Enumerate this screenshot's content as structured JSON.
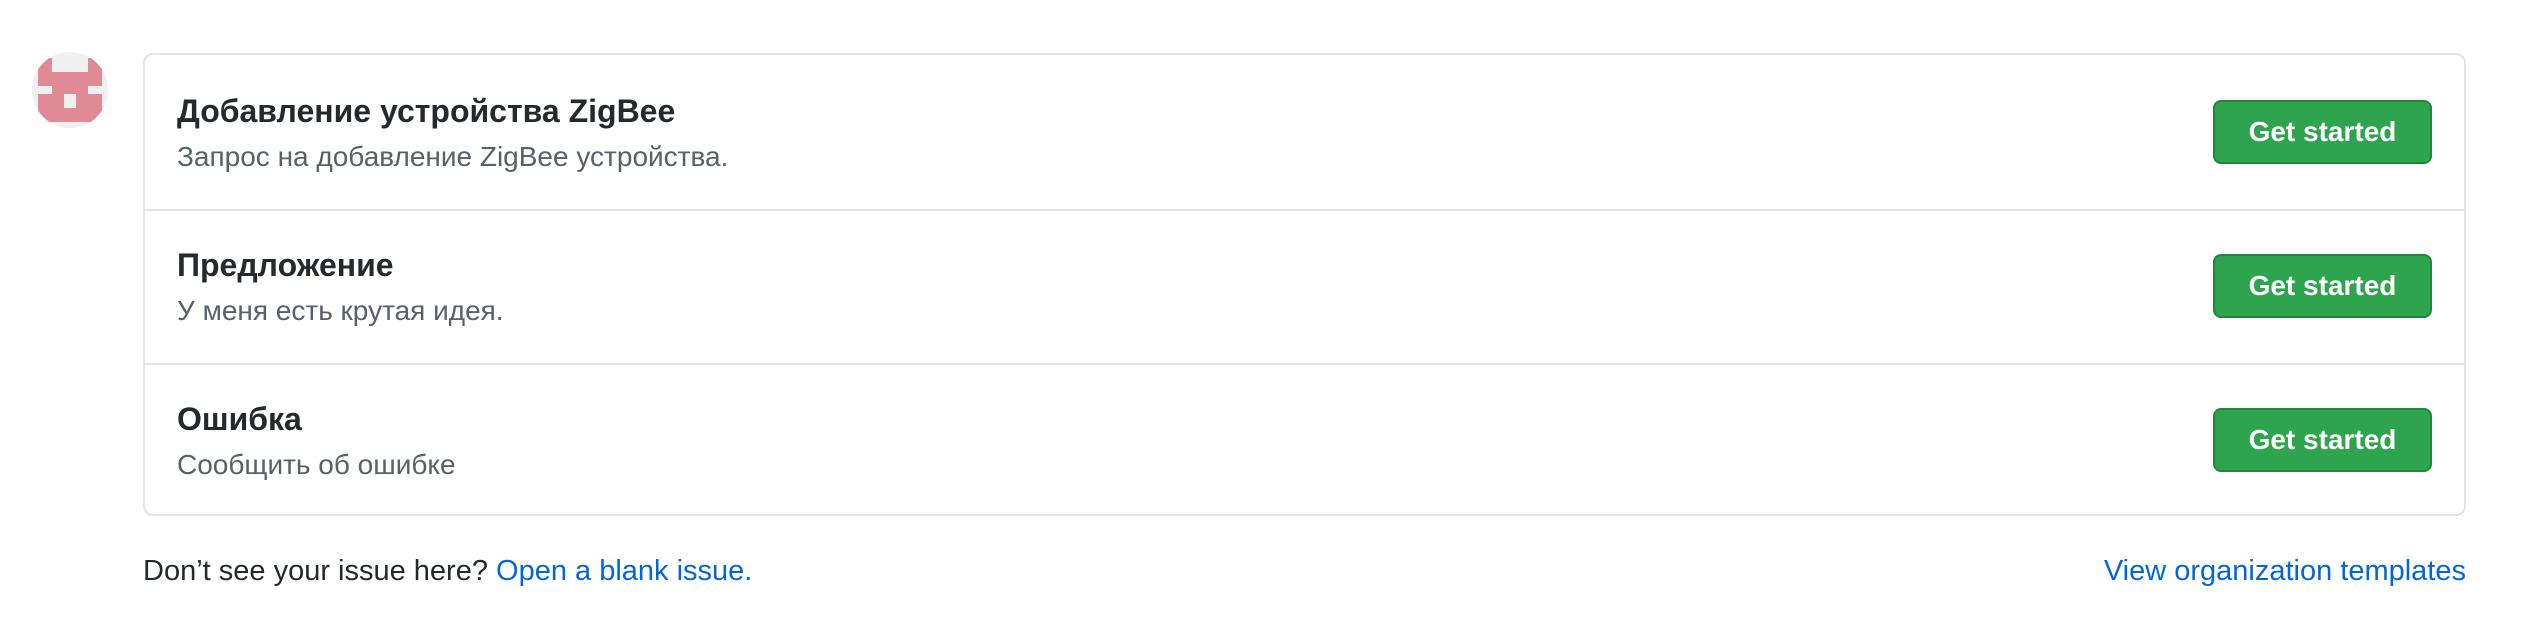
{
  "avatar": {
    "icon": "identicon-avatar",
    "color": "#e08a95"
  },
  "templates": [
    {
      "title": "Добавление устройства ZigBee",
      "description": "Запрос на добавление ZigBee устройства.",
      "button_label": "Get started"
    },
    {
      "title": "Предложение",
      "description": "У меня есть крутая идея.",
      "button_label": "Get started"
    },
    {
      "title": "Ошибка",
      "description": "Сообщить об ошибке",
      "button_label": "Get started"
    }
  ],
  "footer": {
    "prompt": "Don’t see your issue here? ",
    "blank_issue_link": "Open a blank issue.",
    "org_templates_link": "View organization templates"
  },
  "colors": {
    "primary_button": "#2ea44f",
    "link": "#0366d6",
    "border": "#e1e4e8",
    "muted_text": "#586069"
  }
}
